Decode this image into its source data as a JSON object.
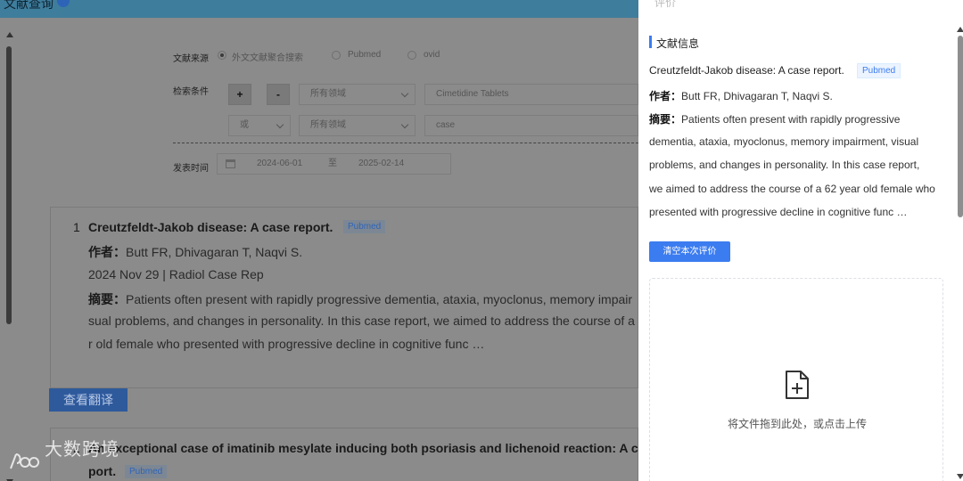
{
  "topbar": {
    "title": "文献查询"
  },
  "search": {
    "source_label": "文献来源",
    "source_options": [
      "外文文献聚合搜索",
      "Pubmed",
      "ovid"
    ],
    "condition_label": "检索条件",
    "add_label": "+",
    "remove_label": "-",
    "row1": {
      "field": "所有领域",
      "value": "Cimetidine Tablets"
    },
    "row2": {
      "logic": "或",
      "field": "所有领域",
      "value": "case"
    },
    "date_label": "发表时间",
    "date_start": "2024-06-01",
    "date_sep": "至",
    "date_end": "2025-02-14"
  },
  "results": [
    {
      "index": "1",
      "title": "Creutzfeldt-Jakob disease: A case report.",
      "source": "Pubmed",
      "author_label": "作者：",
      "authors": "Butt FR, Dhivagaran T, Naqvi S.",
      "meta": "2024 Nov 29 | Radiol Case Rep",
      "abstract_label": "摘要：",
      "abstract_lines": [
        "Patients often present with rapidly progressive dementia, ataxia, myoclonus, memory impair",
        "sual problems, and changes in personality. In this case report, we aimed to address the course of a",
        "r old female who presented with progressive decline in cognitive func …"
      ],
      "translate_label": "查看翻译"
    },
    {
      "index": "2",
      "title": "An exceptional case of imatinib mesylate inducing both psoriasis and lichenoid reaction: A c",
      "title_cont": "port.",
      "source": "Pubmed"
    }
  ],
  "watermark": "大数跨境",
  "drawer": {
    "title": "评价",
    "section_title": "文献信息",
    "paper_title": "Creutzfeldt-Jakob disease: A case report.",
    "source": "Pubmed",
    "author_label": "作者：",
    "authors": "Butt FR, Dhivagaran T, Naqvi S.",
    "abstract_label": "摘要：",
    "abstract_lines": [
      "Patients often present with rapidly progressive",
      "dementia, ataxia, myoclonus, memory impairment, visual",
      "problems, and changes in personality. In this case report,",
      "we aimed to address the course of a 62 year old female who",
      "presented with progressive decline in cognitive func …"
    ],
    "clear_label": "清空本次评价",
    "upload_text": "将文件拖到此处，或点击上传"
  },
  "colors": {
    "accent": "#3b7cf0",
    "overlay": "#8b8b8b",
    "header": "#3f7d9c"
  }
}
